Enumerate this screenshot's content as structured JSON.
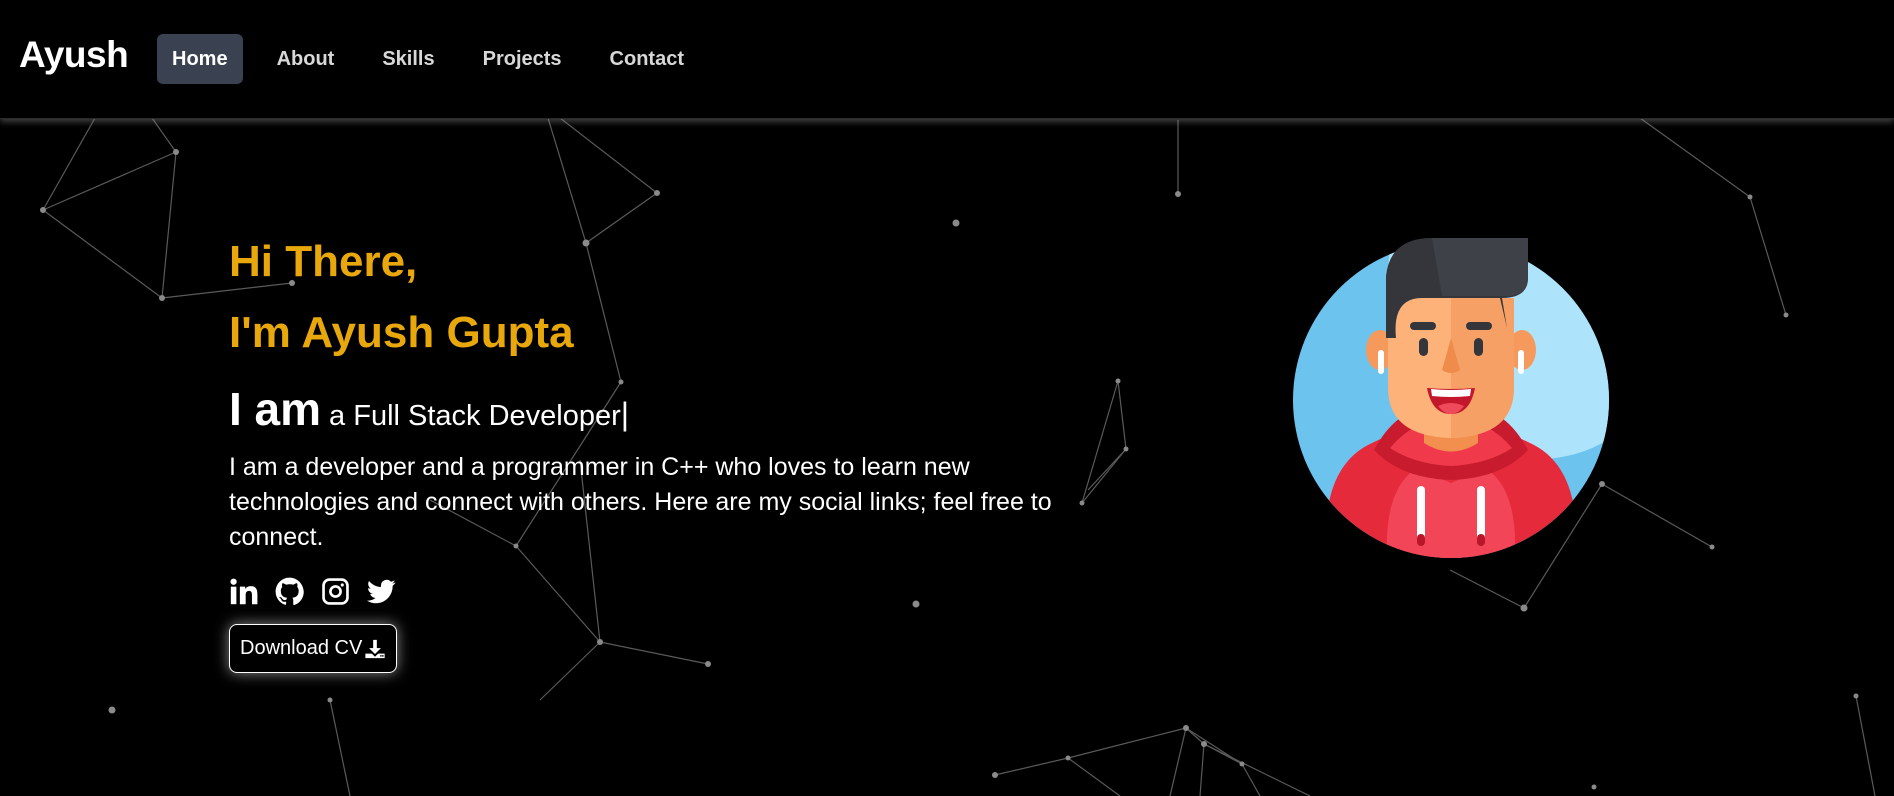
{
  "navbar": {
    "brand": "Ayush",
    "links": [
      {
        "label": "Home",
        "active": true
      },
      {
        "label": "About",
        "active": false
      },
      {
        "label": "Skills",
        "active": false
      },
      {
        "label": "Projects",
        "active": false
      },
      {
        "label": "Contact",
        "active": false
      }
    ]
  },
  "hero": {
    "greeting_line1": "Hi There,",
    "greeting_line2": "I'm Ayush Gupta",
    "role_prefix": "I am",
    "role_text": "a Full Stack Developer",
    "cursor": "|",
    "bio": "I am a developer and a programmer in C++ who loves to learn new technologies and connect with others. Here are my social links; feel free to connect.",
    "socials": [
      {
        "name": "linkedin",
        "icon": "linkedin-icon"
      },
      {
        "name": "github",
        "icon": "github-icon"
      },
      {
        "name": "instagram",
        "icon": "instagram-icon"
      },
      {
        "name": "twitter",
        "icon": "twitter-icon"
      }
    ],
    "download_label": "Download CV",
    "download_icon": "download-icon"
  },
  "colors": {
    "background": "#000000",
    "accent": "#e8a80c",
    "nav_active": "#3a4150",
    "particle": "#8a8a8a"
  }
}
